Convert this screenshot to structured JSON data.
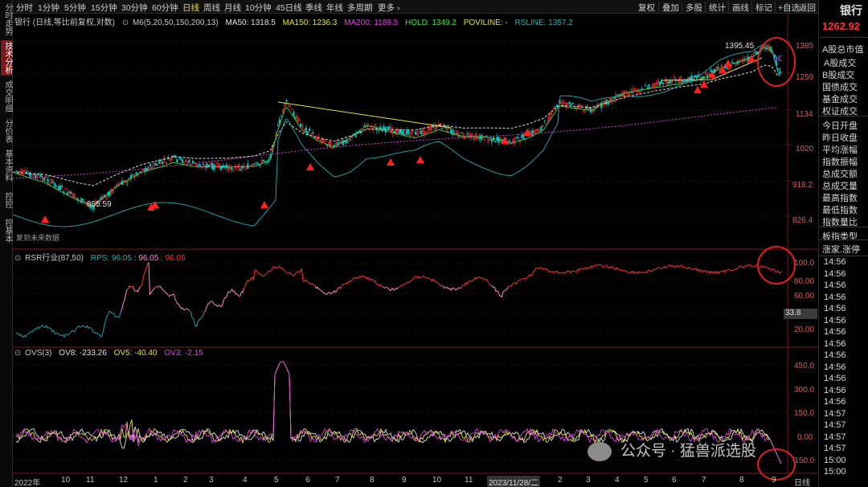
{
  "left_tabs": [
    "分时走势",
    "技术分析",
    "成交明细",
    "分价表",
    "基本资料",
    "控控",
    "控基本"
  ],
  "timeframes": [
    "分时",
    "1分钟",
    "5分钟",
    "15分钟",
    "30分钟",
    "60分钟",
    "日线",
    "周线",
    "月线",
    "10分钟",
    "45日线",
    "季线",
    "年线",
    "多周期",
    "更多 ›"
  ],
  "active_timeframe": "日线",
  "tools": [
    "复权",
    "叠加",
    "多股",
    "统计",
    "画线",
    "标记",
    "+自选",
    "返回"
  ],
  "main_info": {
    "title": "银行 (日线,等比前复权,对数)",
    "m6": "M6(5,20,50,150,200,13)",
    "ma50": "MA50: 1318.5",
    "ma150": "MA150: 1236.3",
    "ma200": "MA200: 1189.5",
    "hold": "HOLD: 1349.2",
    "poviline": "POVILINE: -",
    "rsline": "RSLINE: 1357.2"
  },
  "rsr_info": {
    "label": "RSR行业(87,50)",
    "rps": "RPS: 96.05",
    "v1": ": 96.05",
    "v2": ": 96.05"
  },
  "ovs_info": {
    "label": "OVS(3)",
    "ov8": "OV8: -233.26",
    "ov5": "OV5: -40.40",
    "ov3": "OV3: -2.15"
  },
  "price_axis": [
    "1385",
    "1259",
    "1134",
    "1020",
    "918.2",
    "826.4"
  ],
  "rsr_axis": [
    "100.0",
    "80.00",
    "60.00",
    "33.8",
    "20.00"
  ],
  "ovs_axis": [
    "450.0",
    "300.0",
    "150.0",
    "0.00",
    "-150.0"
  ],
  "annotations": {
    "high": "1395.45",
    "low": "865.59",
    "partial": "9€",
    "future_data": "复到未来数据"
  },
  "x_axis": [
    "2022年",
    "10",
    "11",
    "12",
    "1",
    "2",
    "3",
    "4",
    "5",
    "6",
    "7",
    "8",
    "9",
    "10",
    "11",
    "2023/11/28/二",
    "2",
    "3",
    "4",
    "5",
    "6",
    "7",
    "8",
    "9",
    "日线"
  ],
  "right_panel": {
    "name": "银行",
    "price": "1262.92",
    "items": [
      "A股总市值",
      "A股成交",
      "B股成交",
      "国债成交",
      "基金成交",
      "权证成交",
      "今日开盘",
      "昨日收盘",
      "平均涨幅",
      "指数振幅",
      "总成交额",
      "总成交量",
      "最高指数",
      "最低指数",
      "指数量比",
      "板指类型",
      "涨家.涨停"
    ],
    "times": [
      "14:56",
      "14:56",
      "14:56",
      "14:56",
      "14:56",
      "14:56",
      "14:56",
      "14:56",
      "14:56",
      "14:56",
      "14:56",
      "14:56",
      "14:56",
      "14:57",
      "14:57",
      "14:57",
      "14:57",
      "15:00",
      "15:00"
    ]
  },
  "watermark": "公众号 · 猛兽派选股",
  "colors": {
    "up": "#ff3030",
    "down": "#00c8c8",
    "ma50": "#e0e0e0",
    "ma150": "#e040e0",
    "hold": "#40e040",
    "poviline": "#ffff40",
    "rsline": "#20a0a0",
    "rsr_high": "#ff3030",
    "rsr_mid": "#ff8ac8",
    "rsr_low": "#20a0a0"
  }
}
